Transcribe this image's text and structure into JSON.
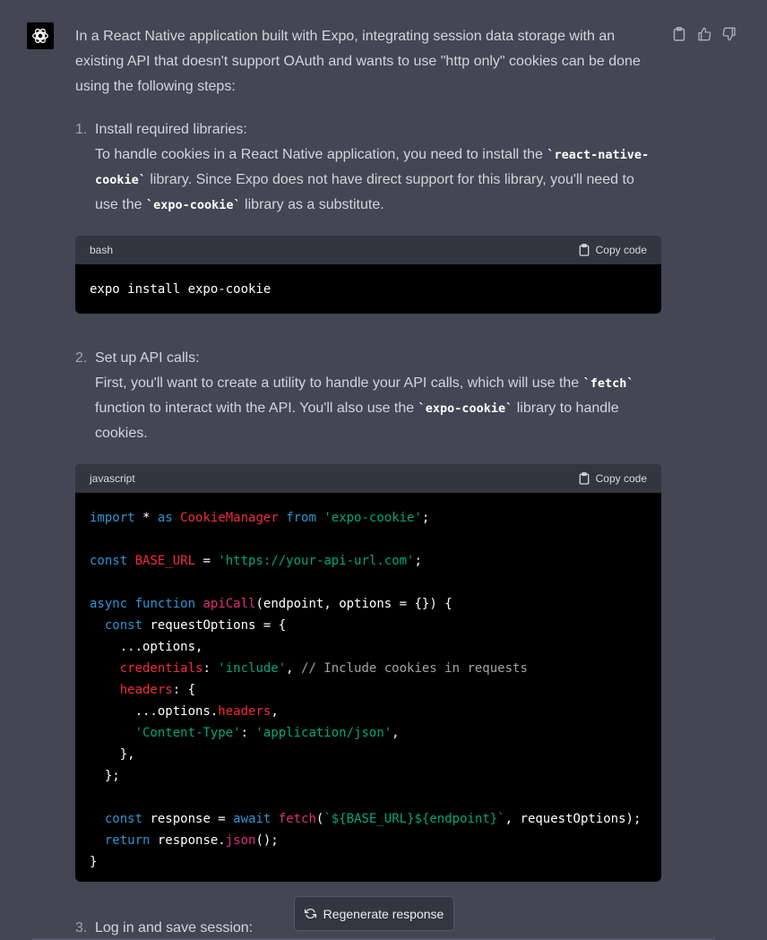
{
  "message": {
    "intro": "In a React Native application built with Expo, integrating session data storage with an existing API that doesn't support OAuth and wants to use \"http only\" cookies can be done using the following steps:",
    "steps": [
      {
        "number": "1.",
        "title": "Install required libraries:",
        "text_a": "To handle cookies in a React Native application, you need to install the ",
        "code_a": "`react-native-cookie`",
        "text_b": " library. Since Expo does not have direct support for this library, you'll need to use the ",
        "code_b": "`expo-cookie`",
        "text_c": " library as a substitute."
      },
      {
        "number": "2.",
        "title": "Set up API calls:",
        "text_a": "First, you'll want to create a utility to handle your API calls, which will use the ",
        "code_a": "`fetch`",
        "text_b": " function to interact with the API. You'll also use the ",
        "code_b": "`expo-cookie`",
        "text_c": " library to handle cookies."
      },
      {
        "number": "3.",
        "title": "Log in and save session:"
      }
    ]
  },
  "code_blocks": [
    {
      "language": "bash",
      "copy_label": "Copy code",
      "lines": [
        "expo install expo-cookie"
      ]
    },
    {
      "language": "javascript",
      "copy_label": "Copy code",
      "lines": [
        "import * as CookieManager from 'expo-cookie';",
        "",
        "const BASE_URL = 'https://your-api-url.com';",
        "",
        "async function apiCall(endpoint, options = {}) {",
        "  const requestOptions = {",
        "    ...options,",
        "    credentials: 'include', // Include cookies in requests",
        "    headers: {",
        "      ...options.headers,",
        "      'Content-Type': 'application/json',",
        "    },",
        "  };",
        "",
        "  const response = await fetch(`${BASE_URL}${endpoint}`, requestOptions);",
        "  return response.json();",
        "}"
      ]
    }
  ],
  "regenerate_label": "Regenerate response",
  "icons": {
    "avatar": "openai-logo-icon",
    "copy": "clipboard-icon",
    "like": "thumbs-up-icon",
    "dislike": "thumbs-down-icon",
    "regenerate": "refresh-icon"
  },
  "colors": {
    "background": "#444654",
    "code_background": "#000000",
    "code_header": "#343541",
    "keyword": "#2e95d3",
    "string": "#00a67d",
    "identifier": "#f22c3d"
  }
}
